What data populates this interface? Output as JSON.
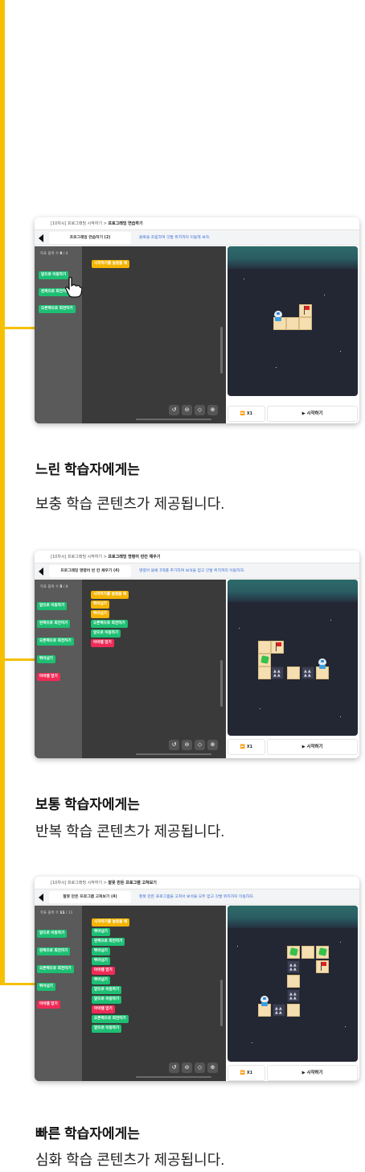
{
  "colors": {
    "accent": "#f6c000",
    "block_green": "#1dbf73",
    "block_yellow": "#f5b400",
    "block_red": "#ee2b56"
  },
  "sections": [
    {
      "breadcrumb_prefix": "[10차시] 프로그래밍 시작하기  >  ",
      "breadcrumb_current": "프로그래밍 연습하기",
      "lesson_tab": "프로그래밍 연습하기 (2)",
      "hint": "블록을 조립하여 깃발 위치까지 이동해 보자.",
      "block_count_label": "목표 블록 수 ",
      "block_count_value": "0",
      "block_count_max": " / 4",
      "palette": [
        "앞으로 이동하기",
        "왼쪽으로 회전하기",
        "오른쪽으로 회전하기"
      ],
      "script": [
        "시작하기를 눌렀을 때"
      ],
      "speed": "X1",
      "start": "시작하기",
      "caption_title": "느린 학습자에게는",
      "caption_desc": "보충 학습 콘텐츠가 제공됩니다."
    },
    {
      "breadcrumb_prefix": "[10차시] 프로그래밍 시작하기  >  ",
      "breadcrumb_current": "프로그래밍 명령어 빈칸 채우기",
      "lesson_tab": "프로그래밍 명령어 빈 칸 채우기 (4)",
      "hint": "명령어 블록 3개를 추가하여 보석을 얻고 깃발 위치까지 이동하자.",
      "block_count_label": "목표 블록 수 ",
      "block_count_value": "5",
      "block_count_max": " / 8",
      "palette": [
        "앞으로 이동하기",
        "왼쪽으로 회전하기",
        "오른쪽으로 회전하기",
        "뛰어넘기",
        "아이템 얻기"
      ],
      "script": [
        "시작하기를 눌렀을 때",
        "뛰어넘기",
        "뛰어넘기",
        "오른쪽으로 회전하기",
        "앞으로 이동하기",
        "아이템 얻기"
      ],
      "speed": "X1",
      "start": "시작하기",
      "caption_title": "보통 학습자에게는",
      "caption_desc": "반복 학습 콘텐츠가 제공됩니다."
    },
    {
      "breadcrumb_prefix": "[10차시] 프로그래밍 시작하기  >  ",
      "breadcrumb_current": "잘못 만든 프로그램 고쳐보기",
      "lesson_tab": "잘못 만든 프로그램 고쳐보기 (4)",
      "hint": "잘못 만든 프로그램을 고쳐서 보석을 모두 얻고 깃발 위치까지 이동하자.",
      "block_count_label": "목표 블록 수 ",
      "block_count_value": "11",
      "block_count_max": " / 11",
      "palette": [
        "앞으로 이동하기",
        "왼쪽으로 회전하기",
        "오른쪽으로 회전하기",
        "뛰어넘기",
        "아이템 얻기"
      ],
      "script": [
        "시작하기를 눌렀을 때",
        "뛰어넘기",
        "왼쪽으로 회전하기",
        "뛰어넘기",
        "뛰어넘기",
        "아이템 얻기",
        "뛰어넘기",
        "앞으로 이동하기",
        "앞으로 이동하기",
        "아이템 얻기",
        "오른쪽으로 회전하기",
        "앞으로 이동하기"
      ],
      "speed": "X1",
      "start": "시작하기",
      "caption_title": "빠른 학습자에게는",
      "caption_desc": "심화 학습 콘텐츠가 제공됩니다."
    }
  ],
  "icons": [
    "back-arrow-icon",
    "hand-cursor-icon",
    "undo-icon",
    "zoom-out-icon",
    "zoom-reset-icon",
    "zoom-in-icon",
    "fast-forward-icon",
    "play-icon",
    "flag-icon",
    "gem-icon",
    "robot-icon"
  ]
}
